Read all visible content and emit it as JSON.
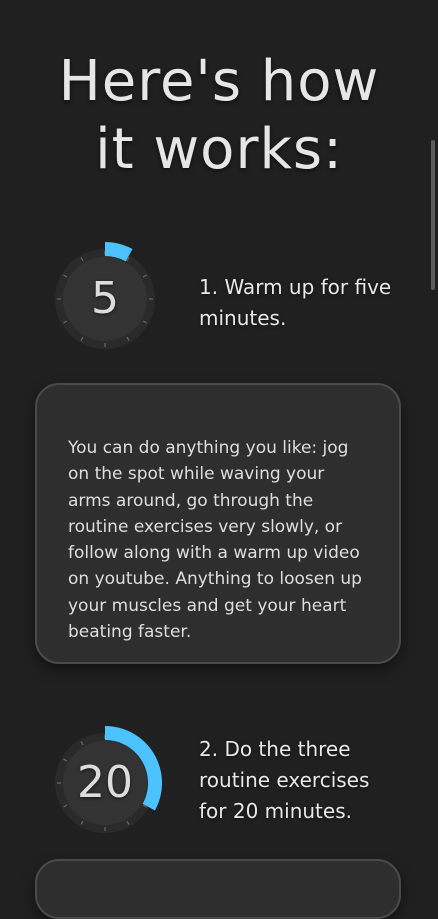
{
  "heading": {
    "line1": "Here's how",
    "line2": "it works:"
  },
  "steps": [
    {
      "dial_number": "5",
      "dial_progress": 0.08,
      "text": "1. Warm up for five minutes.",
      "description": "You can do anything you like: jog on the spot while waving your arms around, go through the routine exercises very slowly, or follow along with a warm up video on youtube. Anything to loosen up your muscles and get your heart beating faster."
    },
    {
      "dial_number": "20",
      "dial_progress": 0.33,
      "text": "2. Do the three routine exercises for 20 minutes."
    }
  ],
  "colors": {
    "background": "#202020",
    "card": "#2e2e2e",
    "accent": "#4cc2ff"
  }
}
